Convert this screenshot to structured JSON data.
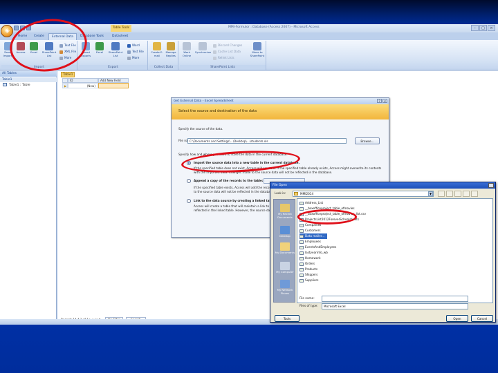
{
  "colors": {
    "annotation": "#e0101a",
    "slide_background": "#0036b8",
    "dialog_banner": "#f2b53b",
    "selection": "#316ac5"
  },
  "app": {
    "window_title": "MMI-Formulor : Database (Access 2007) - Microsoft Access",
    "contextual_tab": "Table Tools",
    "tabs": [
      "Home",
      "Create",
      "External Data",
      "Database Tools",
      "Datasheet"
    ],
    "active_tab_index": 2,
    "ribbon": {
      "import_group": "Import",
      "export_group": "Export",
      "collect_group": "Collect Data",
      "sharepoint_group": "SharePoint Lists",
      "import_buttons": [
        "Saved Imports",
        "Access",
        "Excel",
        "SharePoint List"
      ],
      "import_small": [
        "Text File",
        "XML File",
        "More"
      ],
      "export_buttons": [
        "Saved Exports",
        "Excel",
        "SharePoint List"
      ],
      "export_small": [
        "Word",
        "Text File",
        "More"
      ],
      "collect_buttons": [
        "Create E-mail",
        "Manage Replies"
      ],
      "sharepoint_buttons": [
        "Work Online",
        "Synchronize"
      ],
      "sharepoint_small": [
        "Discard Changes",
        "Cache List Data",
        "Relink Lists"
      ],
      "sharepoint_move": "Move to SharePoint"
    },
    "nav_pane": {
      "header": "All Tables",
      "group": "Table1",
      "item": "Table1 : Table"
    },
    "document": {
      "tab_label": "Table1",
      "columns": [
        "ID",
        "Add New Field"
      ],
      "new_row_value": "(New)",
      "record_nav": "Record: 14 4 1 of 1 ▶ ▶| ▶*",
      "no_filter": "No Filter",
      "search": "Search"
    }
  },
  "get_external_data": {
    "title": "Get External Data - Excel Spreadsheet",
    "banner": "Select the source and destination of the data",
    "specify_source": "Specify the source of the data.",
    "file_name_label": "File name:",
    "file_name_value": "C:\\Documents and Settings\\...\\Desktop\\...\\students.xls",
    "browse_button": "Browse...",
    "specify_store": "Specify how and where you want to store the data in the current database.",
    "option1_title": "Import the source data into a new table in the current database.",
    "option1_desc1": "If the specified table does not exist, Access will create it. If the specified table already exists, Access might overwrite its contents",
    "option1_desc2": "with the imported data. Changes made to the source data will not be reflected in the database.",
    "option2_title": "Append a copy of the records to the table:",
    "option2_desc1": "If the specified table exists, Access will add the records to the table. If the table does not exist, Access will create it.",
    "option2_desc2": "to the source data will not be reflected in the database.",
    "option3_title": "Link to the data source by creating a linked table.",
    "option3_desc1": "Access will create a table that will maintain a link to the source data in Excel. Changes made",
    "option3_desc2": "reflected in the linked table. However, the source data cannot be changed from within Access."
  },
  "file_open": {
    "title": "File Open",
    "look_in_label": "Look in:",
    "look_in_value": "MMI2014",
    "places": [
      "My Recent Documents",
      "Desktop",
      "My Documents",
      "My Computer",
      "My Network Places"
    ],
    "files": [
      "Address_List",
      "__boxofficeproject_table_ofmovies",
      "__boxofficeproject_table_ofmovies_list.csv",
      "ProjectsList2012ForeverSchoolsheets",
      "Companies",
      "Customers",
      "Data mailer...",
      "Employees",
      "EventsAndEmployees",
      "lastyearinfo_wb",
      "Homework",
      "Orders",
      "Products",
      "Shippers",
      "Suppliers"
    ],
    "selected_index": 6,
    "file_name_label": "File name:",
    "file_name_value": "",
    "files_of_type_label": "Files of type:",
    "files_of_type_value": "Microsoft Excel",
    "tools_button": "Tools",
    "open_button": "Open",
    "cancel_button": "Cancel"
  }
}
